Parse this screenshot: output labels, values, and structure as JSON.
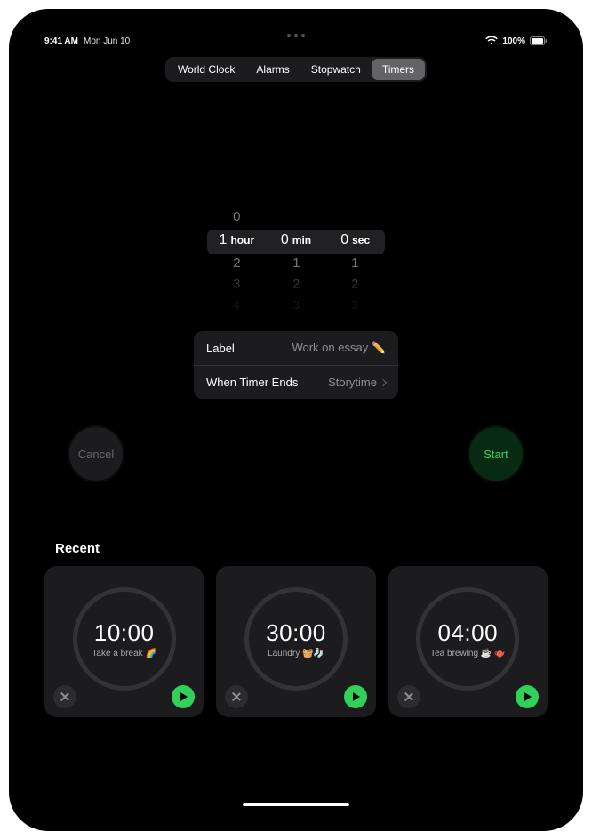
{
  "status": {
    "time": "9:41 AM",
    "date": "Mon Jun 10",
    "battery": "100%"
  },
  "tabs": {
    "items": [
      "World Clock",
      "Alarms",
      "Stopwatch",
      "Timers"
    ],
    "active": "Timers"
  },
  "picker": {
    "hours": {
      "selected": "1",
      "unit": "hour",
      "above": [
        "0"
      ],
      "below": [
        "2",
        "3",
        "4"
      ]
    },
    "minutes": {
      "selected": "0",
      "unit": "min",
      "above": [],
      "below": [
        "1",
        "2",
        "3"
      ]
    },
    "seconds": {
      "selected": "0",
      "unit": "sec",
      "above": [],
      "below": [
        "1",
        "2",
        "3"
      ]
    }
  },
  "settings": {
    "label_key": "Label",
    "label_value": "Work on essay ✏️",
    "ends_key": "When Timer Ends",
    "ends_value": "Storytime"
  },
  "buttons": {
    "cancel": "Cancel",
    "start": "Start"
  },
  "recent": {
    "title": "Recent",
    "items": [
      {
        "time": "10:00",
        "label": "Take a break 🌈"
      },
      {
        "time": "30:00",
        "label": "Laundry 🧺🧦"
      },
      {
        "time": "04:00",
        "label": "Tea brewing ☕️ 🫖"
      }
    ]
  }
}
